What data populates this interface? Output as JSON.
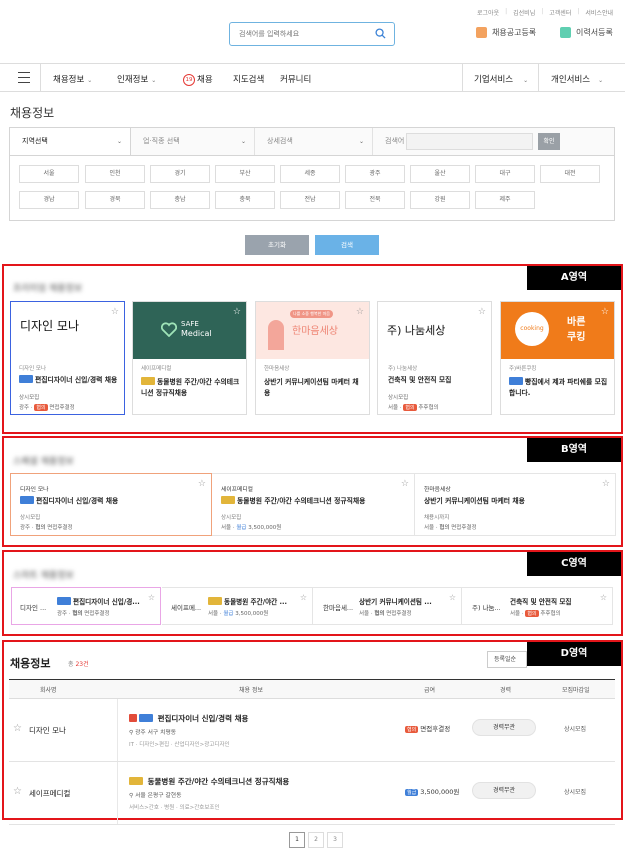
{
  "header": {
    "top_links": [
      "로그아웃",
      "김선비님",
      "고객센터",
      "서비스안내"
    ],
    "search_placeholder": "검색어를 입력하세요",
    "post_job": "채용공고등록",
    "resume": "이력서등록"
  },
  "nav": {
    "items": [
      "채용정보",
      "인재정보",
      "채용",
      "지도검색",
      "커뮤니티"
    ],
    "badge": "19",
    "right": [
      "기업서비스",
      "개인서비스"
    ]
  },
  "page_title": "채용정보",
  "filter": {
    "region_select": "지역선택",
    "job_select": "업·직종 선택",
    "detail_select": "상세검색",
    "keyword_label": "검색어",
    "keyword_btn": "확인",
    "regions_row1": [
      "서울",
      "인천",
      "경기",
      "부산",
      "세종",
      "광주",
      "울산",
      "대구",
      "대전"
    ],
    "regions_row2": [
      "경남",
      "경북",
      "충남",
      "충북",
      "전남",
      "전북",
      "강원",
      "제주"
    ],
    "reset": "초기화",
    "search": "검색"
  },
  "sections": {
    "a": {
      "tag": "A영역",
      "heading": "프리미엄 채용정보"
    },
    "b": {
      "tag": "B영역",
      "heading": "스페셜 채용정보"
    },
    "c": {
      "tag": "C영역",
      "heading": "스마트 채용정보"
    },
    "d": {
      "tag": "D영역"
    }
  },
  "premium": [
    {
      "logo": "디자인 모나",
      "company": "디자인 모나",
      "title": "편집디자이너 신입/경력 채용",
      "m1": "상시모집",
      "loc": "광주",
      "pay": "협의",
      "pay_note": "면접후결정"
    },
    {
      "logo_l1": "SAFE",
      "logo_l2": "Medical",
      "company": "세이프메디컬",
      "title": "동물병원 주간/야간 수의테크니션 정규직채용",
      "m1": "",
      "loc": "",
      "pay": "",
      "pay_note": ""
    },
    {
      "logo_small": "나를 소중 행복한 마음",
      "logo": "한마음세상",
      "company": "한마음세상",
      "title": "상반기 커뮤니케이션팀 마케터 채용",
      "m1": "",
      "loc": "",
      "pay": "",
      "pay_note": ""
    },
    {
      "logo": "주) 나눔세상",
      "company": "주) 나눔세상",
      "title": "건축직 및 안전직 모집",
      "m1": "상시모집",
      "loc": "서울",
      "pay": "협의",
      "pay_note": "추후협의"
    },
    {
      "logo_l1": "바른",
      "logo_l2": "쿠킹",
      "logo_circle": "cooking",
      "company": "주)바른쿠킹",
      "title": "빵집에서 제과 파티쉐를 모집 합니다.",
      "m1": "",
      "loc": "",
      "pay": "",
      "pay_note": ""
    }
  ],
  "special": [
    {
      "company": "디자인 모나",
      "title": "편집디자이너 신입/경력 채용",
      "m1": "상시모집",
      "loc": "광주",
      "pay": "협의",
      "pay_note": "면접후결정"
    },
    {
      "company": "세이프메디컬",
      "title": "동물병원 주간/야간 수의테크니션 정규직채용",
      "m1": "상시모집",
      "loc": "서울",
      "pay": "월급",
      "pay_note": "3,500,000원"
    },
    {
      "company": "한마음세상",
      "title": "상반기 커뮤니케이션팀 마케터 채용",
      "m1": "채용시까지",
      "loc": "서울",
      "pay": "협의",
      "pay_note": "면접후결정"
    }
  ],
  "smart": [
    {
      "company": "디자인 ...",
      "title": "편집디자이너 신입/경...",
      "loc": "광주",
      "pay": "협의",
      "pay_note": "면접후결정"
    },
    {
      "company": "세이프메...",
      "title": "동물병원 주간/야간 ...",
      "loc": "서울",
      "pay": "월급",
      "pay_note": "3,500,000원"
    },
    {
      "company": "한마음세...",
      "title": "상반기 커뮤니케이션팀 ...",
      "loc": "서울",
      "pay": "협의",
      "pay_note": "면접후결정"
    },
    {
      "company": "주) 나눔...",
      "title": "건축직 및 안전직 모집",
      "loc": "서울",
      "pay": "협의",
      "pay_note": "추후협의"
    }
  ],
  "list": {
    "title": "채용정보",
    "count_label": "총",
    "count": "23건",
    "sort": "등록일순",
    "columns": [
      "회사명",
      "채용 정보",
      "급여",
      "경력",
      "모집마감일"
    ],
    "rows": [
      {
        "company": "디자인 모나",
        "title": "편집디자이너 신입/경력 채용",
        "loc": "광주 서구 치평동",
        "cat": "IT · 디자인>편집 · 산업디자인>광고디자인",
        "pay": "협의",
        "pay_note": "면접후결정",
        "exp": "경력무관",
        "deadline": "상시모집"
      },
      {
        "company": "세이프메디컬",
        "title": "동물병원 주간/야간 수의테크니션 정규직채용",
        "loc": "서울 은평구 갈현동",
        "cat": "서비스>간호 · 병원 · 의료>간호보조인",
        "pay": "월급",
        "pay_note": "3,500,000원",
        "exp": "경력무관",
        "deadline": "상시모집"
      }
    ]
  },
  "pagination": [
    "1",
    "2",
    "3"
  ],
  "colors": {
    "accent": "#e3151a",
    "primary": "#6ab2e7",
    "brand_green": "#2f6457",
    "brand_orange": "#f07b1a"
  }
}
